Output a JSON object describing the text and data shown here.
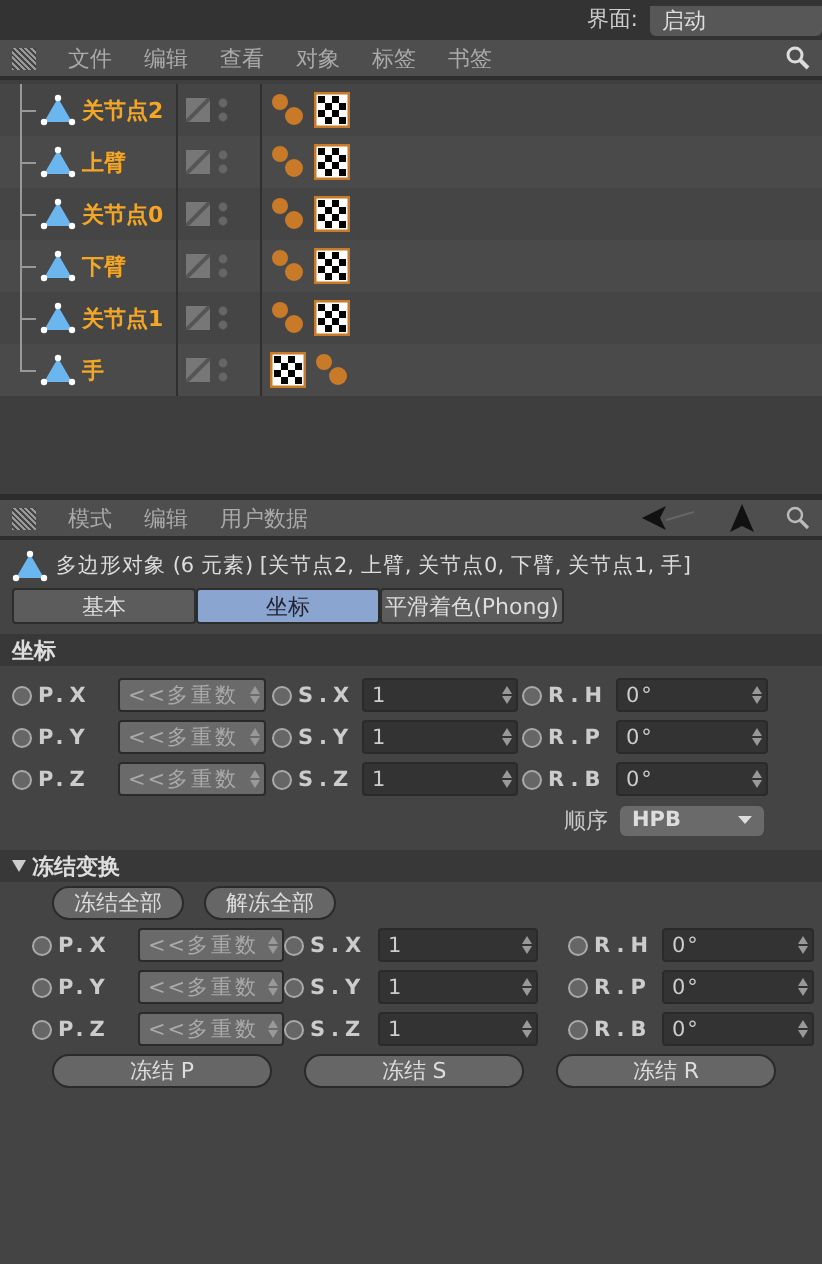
{
  "interface_bar": {
    "label": "界面:",
    "value": "启动"
  },
  "object_manager": {
    "menu": [
      "文件",
      "编辑",
      "查看",
      "对象",
      "标签",
      "书签"
    ],
    "objects": [
      {
        "name": "关节点2",
        "tags": [
          {
            "kind": "weight"
          },
          {
            "kind": "texture"
          }
        ]
      },
      {
        "name": "上臂",
        "tags": [
          {
            "kind": "weight"
          },
          {
            "kind": "texture"
          }
        ]
      },
      {
        "name": "关节点0",
        "tags": [
          {
            "kind": "weight"
          },
          {
            "kind": "texture"
          }
        ]
      },
      {
        "name": "下臂",
        "tags": [
          {
            "kind": "weight"
          },
          {
            "kind": "texture"
          }
        ]
      },
      {
        "name": "关节点1",
        "tags": [
          {
            "kind": "weight"
          },
          {
            "kind": "texture"
          }
        ]
      },
      {
        "name": "手",
        "tags": [
          {
            "kind": "texture"
          },
          {
            "kind": "weight"
          }
        ]
      }
    ]
  },
  "attribute_manager": {
    "menu": [
      "模式",
      "编辑",
      "用户数据"
    ],
    "title": "多边形对象 (6 元素) [关节点2, 上臂, 关节点0, 下臂, 关节点1, 手]",
    "tabs": [
      {
        "label": "基本",
        "selected": false
      },
      {
        "label": "坐标",
        "selected": true
      },
      {
        "label": "平滑着色(Phong)",
        "selected": false
      }
    ],
    "coordinates": {
      "title": "坐标",
      "rows": [
        [
          {
            "label": "P.X",
            "value": "<<多重数",
            "multi": true,
            "keyed": false
          },
          {
            "label": "S.X",
            "value": "1",
            "multi": false,
            "keyed": false
          },
          {
            "label": "R.H",
            "value": "0°",
            "multi": false,
            "keyed": false
          }
        ],
        [
          {
            "label": "P.Y",
            "value": "<<多重数",
            "multi": true,
            "keyed": false
          },
          {
            "label": "S.Y",
            "value": "1",
            "multi": false,
            "keyed": false
          },
          {
            "label": "R.P",
            "value": "0°",
            "multi": false,
            "keyed": false
          }
        ],
        [
          {
            "label": "P.Z",
            "value": "<<多重数",
            "multi": true,
            "keyed": false
          },
          {
            "label": "S.Z",
            "value": "1",
            "multi": false,
            "keyed": false
          },
          {
            "label": "R.B",
            "value": "0°",
            "multi": false,
            "keyed": false
          }
        ]
      ],
      "order": {
        "label": "顺序",
        "value": "HPB"
      }
    },
    "freeze": {
      "title": "冻结变换",
      "expanded": true,
      "buttons": [
        "冻结全部",
        "解冻全部"
      ],
      "rows": [
        [
          {
            "label": "P.X",
            "value": "<<多重数",
            "multi": true,
            "keyed": false
          },
          {
            "label": "S.X",
            "value": "1",
            "multi": false,
            "keyed": false
          },
          {
            "label": "R.H",
            "value": "0°",
            "multi": false,
            "keyed": false
          }
        ],
        [
          {
            "label": "P.Y",
            "value": "<<多重数",
            "multi": true,
            "keyed": false
          },
          {
            "label": "S.Y",
            "value": "1",
            "multi": false,
            "keyed": false
          },
          {
            "label": "R.P",
            "value": "0°",
            "multi": false,
            "keyed": false
          }
        ],
        [
          {
            "label": "P.Z",
            "value": "<<多重数",
            "multi": true,
            "keyed": false
          },
          {
            "label": "S.Z",
            "value": "1",
            "multi": false,
            "keyed": false
          },
          {
            "label": "R.B",
            "value": "0°",
            "multi": false,
            "keyed": false
          }
        ]
      ],
      "freeze_buttons": [
        "冻结 P",
        "冻结 S",
        "冻结 R"
      ]
    }
  }
}
